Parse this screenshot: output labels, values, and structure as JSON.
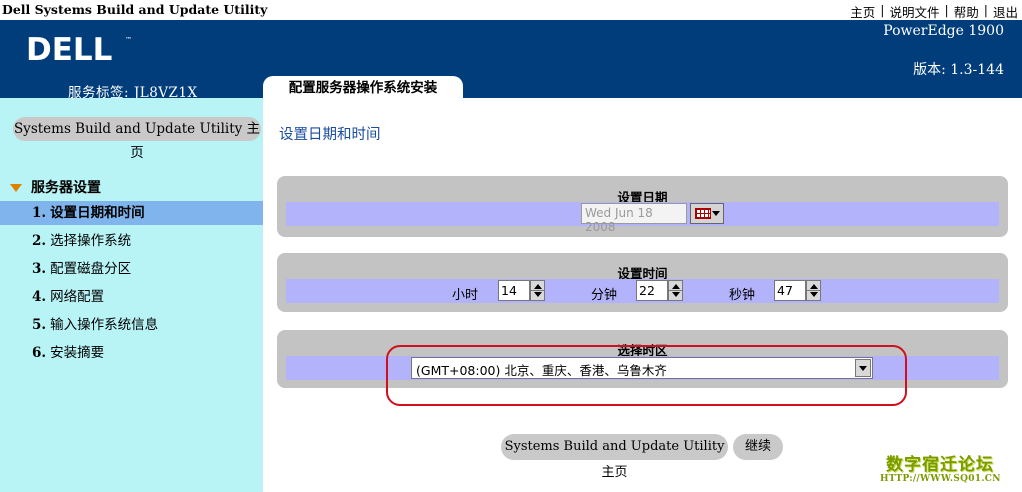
{
  "app_title": "Dell Systems Build and Update Utility",
  "top_links": [
    "主页",
    "说明文件",
    "帮助",
    "退出"
  ],
  "header": {
    "logo_text": "DELL",
    "model": "PowerEdge 1900",
    "version": "版本: 1.3-144",
    "service_tag": "服务标签: JL8VZ1X",
    "active_tab": "配置服务器操作系统安装"
  },
  "sidebar": {
    "home_button": "Systems Build and Update Utility 主页",
    "section_label": "服务器设置",
    "steps": [
      {
        "num": "1.",
        "label": "设置日期和时间",
        "active": true
      },
      {
        "num": "2.",
        "label": "选择操作系统",
        "active": false
      },
      {
        "num": "3.",
        "label": "配置磁盘分区",
        "active": false
      },
      {
        "num": "4.",
        "label": "网络配置",
        "active": false
      },
      {
        "num": "5.",
        "label": "输入操作系统信息",
        "active": false
      },
      {
        "num": "6.",
        "label": "安装摘要",
        "active": false
      }
    ]
  },
  "main": {
    "page_title": "设置日期和时间",
    "date_panel": {
      "title": "设置日期",
      "date_value": "Wed Jun 18 2008"
    },
    "time_panel": {
      "title": "设置时间",
      "hour_label": "小时",
      "hour_value": "14",
      "minute_label": "分钟",
      "minute_value": "22",
      "second_label": "秒钟",
      "second_value": "47"
    },
    "tz_panel": {
      "title": "选择时区",
      "selected": "(GMT+08:00) 北京、重庆、香港、乌鲁木齐"
    }
  },
  "buttons": {
    "home": "Systems Build and Update Utility 主页",
    "continue": "继续"
  },
  "watermark": {
    "text": "数字宿迁论坛",
    "url": "HTTP://WWW.SQ01.CN"
  },
  "colors": {
    "header_blue": "#003d7a",
    "sidebar_cyan": "#b8f3f6",
    "active_step": "#7fb4ec",
    "panel_gray": "#c3c3c3",
    "row_lavender": "#b3b3fb",
    "highlight_red": "#d0101c"
  }
}
